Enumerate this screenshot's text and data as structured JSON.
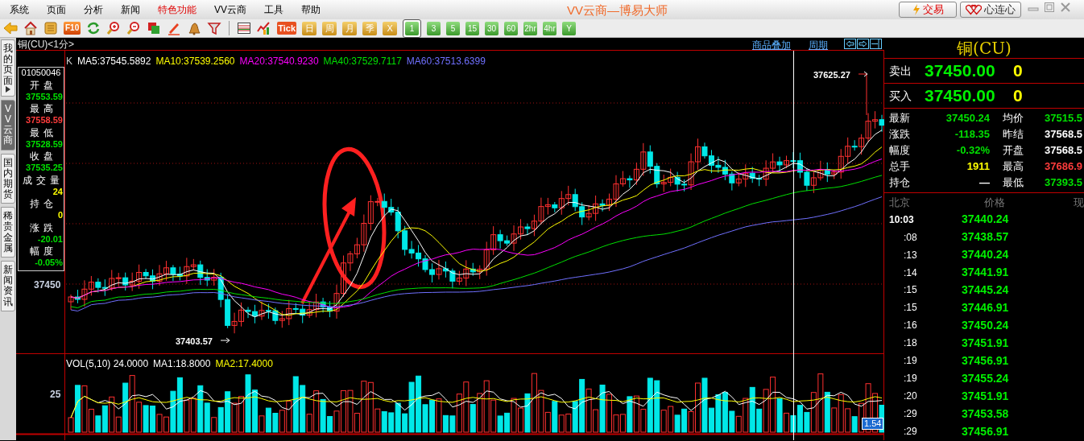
{
  "window": {
    "title": "VV云商—博易大师"
  },
  "menu": [
    {
      "label": "系统",
      "highlighted": false
    },
    {
      "label": "页面",
      "highlighted": false
    },
    {
      "label": "分析",
      "highlighted": false
    },
    {
      "label": "新闻",
      "highlighted": false
    },
    {
      "label": "特色功能",
      "highlighted": true
    },
    {
      "label": "VV云商",
      "highlighted": false
    },
    {
      "label": "工具",
      "highlighted": false
    },
    {
      "label": "帮助",
      "highlighted": false
    }
  ],
  "title_buttons": [
    "交易",
    "心连心"
  ],
  "toolbar": {
    "f10_label": "F10",
    "tick_label": "Tick",
    "calendar_buttons": [
      "日",
      "周",
      "月",
      "季",
      "X"
    ],
    "periods": [
      {
        "label": "1",
        "selected": true
      },
      {
        "label": "3",
        "selected": false
      },
      {
        "label": "5",
        "selected": false
      },
      {
        "label": "15",
        "selected": false
      },
      {
        "label": "30",
        "selected": false
      },
      {
        "label": "60",
        "selected": false
      },
      {
        "label": "2hr",
        "selected": false
      },
      {
        "label": "4hr",
        "selected": false
      },
      {
        "label": "Y",
        "selected": false
      }
    ]
  },
  "side_tabs": [
    {
      "label": "我的页面",
      "selected": false
    },
    {
      "label": "VV云商",
      "selected": true
    },
    {
      "label": "国内期货",
      "selected": false
    },
    {
      "label": "稀贵金属",
      "selected": false
    },
    {
      "label": "新闻资讯",
      "selected": false
    }
  ],
  "chart_header": {
    "title": "铜(CU)<1分>",
    "links": [
      "商品叠加",
      "周期"
    ]
  },
  "info_box": {
    "code": "01050046",
    "items": [
      {
        "label": "开盘",
        "value": "37553.59",
        "color": "#00e000"
      },
      {
        "label": "最高",
        "value": "37558.59",
        "color": "#ff3c3c"
      },
      {
        "label": "最低",
        "value": "37528.59",
        "color": "#00e000"
      },
      {
        "label": "收盘",
        "value": "37535.25",
        "color": "#00e000"
      },
      {
        "label": "成交量",
        "value": "24",
        "color": "#ffff00"
      },
      {
        "label": "持仓",
        "value": "0",
        "color": "#ffff00"
      },
      {
        "label": "涨跌",
        "value": "-20.01",
        "color": "#00e000"
      },
      {
        "label": "幅度",
        "value": "-0.05%",
        "color": "#00e000"
      }
    ]
  },
  "price_chart": {
    "type_label": "K",
    "ma_legend": [
      {
        "label": "MA5:37545.5892",
        "color": "#ffffff"
      },
      {
        "label": "MA10:37539.2560",
        "color": "#ffff00"
      },
      {
        "label": "MA20:37540.9230",
        "color": "#ff00ff"
      },
      {
        "label": "MA40:37529.7117",
        "color": "#00e000"
      },
      {
        "label": "MA60:37513.6399",
        "color": "#7070ff"
      }
    ],
    "axis_label": "37450",
    "high_marker": "37625.27",
    "low_marker": "37403.57"
  },
  "volume_chart": {
    "legend": [
      {
        "label": "VOL(5,10) 24.0000",
        "color": "#ffffff"
      },
      {
        "label": "MA1:18.8000",
        "color": "#ffffff"
      },
      {
        "label": "MA2:17.4000",
        "color": "#ffff00"
      }
    ],
    "axis_label": "25",
    "badge": "1.54"
  },
  "quote": {
    "title": "铜(CU)",
    "sell": {
      "label": "卖出",
      "price": "37450.00",
      "volume": "0"
    },
    "buy": {
      "label": "买入",
      "price": "37450.00",
      "volume": "0"
    },
    "stats": [
      {
        "left": {
          "label": "最新",
          "value": "37450.24",
          "color": "#00e000"
        },
        "right": {
          "label": "均价",
          "value": "37515.5",
          "color": "#00e000"
        }
      },
      {
        "left": {
          "label": "涨跌",
          "value": "-118.35",
          "color": "#00e000"
        },
        "right": {
          "label": "昨结",
          "value": "37568.5",
          "color": "#ffffff"
        }
      },
      {
        "left": {
          "label": "幅度",
          "value": "-0.32%",
          "color": "#00e000"
        },
        "right": {
          "label": "开盘",
          "value": "37568.5",
          "color": "#ffffff"
        }
      },
      {
        "left": {
          "label": "总手",
          "value": "1911",
          "color": "#ffff00"
        },
        "right": {
          "label": "最高",
          "value": "37686.9",
          "color": "#ff3c3c"
        }
      },
      {
        "left": {
          "label": "持仓",
          "value": "—",
          "color": "#ffffff"
        },
        "right": {
          "label": "最低",
          "value": "37393.5",
          "color": "#00e000"
        }
      }
    ],
    "ticks_header": [
      "北京",
      "价格",
      "现"
    ],
    "ticks": [
      {
        "time": "10:03",
        "price": "37440.24"
      },
      {
        "time": ":08",
        "price": "37438.57"
      },
      {
        "time": ":13",
        "price": "37440.24"
      },
      {
        "time": ":14",
        "price": "37441.91"
      },
      {
        "time": ":15",
        "price": "37445.24"
      },
      {
        "time": ":15",
        "price": "37446.91"
      },
      {
        "time": ":16",
        "price": "37450.24"
      },
      {
        "time": ":18",
        "price": "37451.91"
      },
      {
        "time": ":19",
        "price": "37456.91"
      },
      {
        "time": ":19",
        "price": "37455.24"
      },
      {
        "time": ":20",
        "price": "37451.91"
      },
      {
        "time": ":29",
        "price": "37453.58"
      },
      {
        "time": ":29",
        "price": "37456.91"
      }
    ]
  }
}
